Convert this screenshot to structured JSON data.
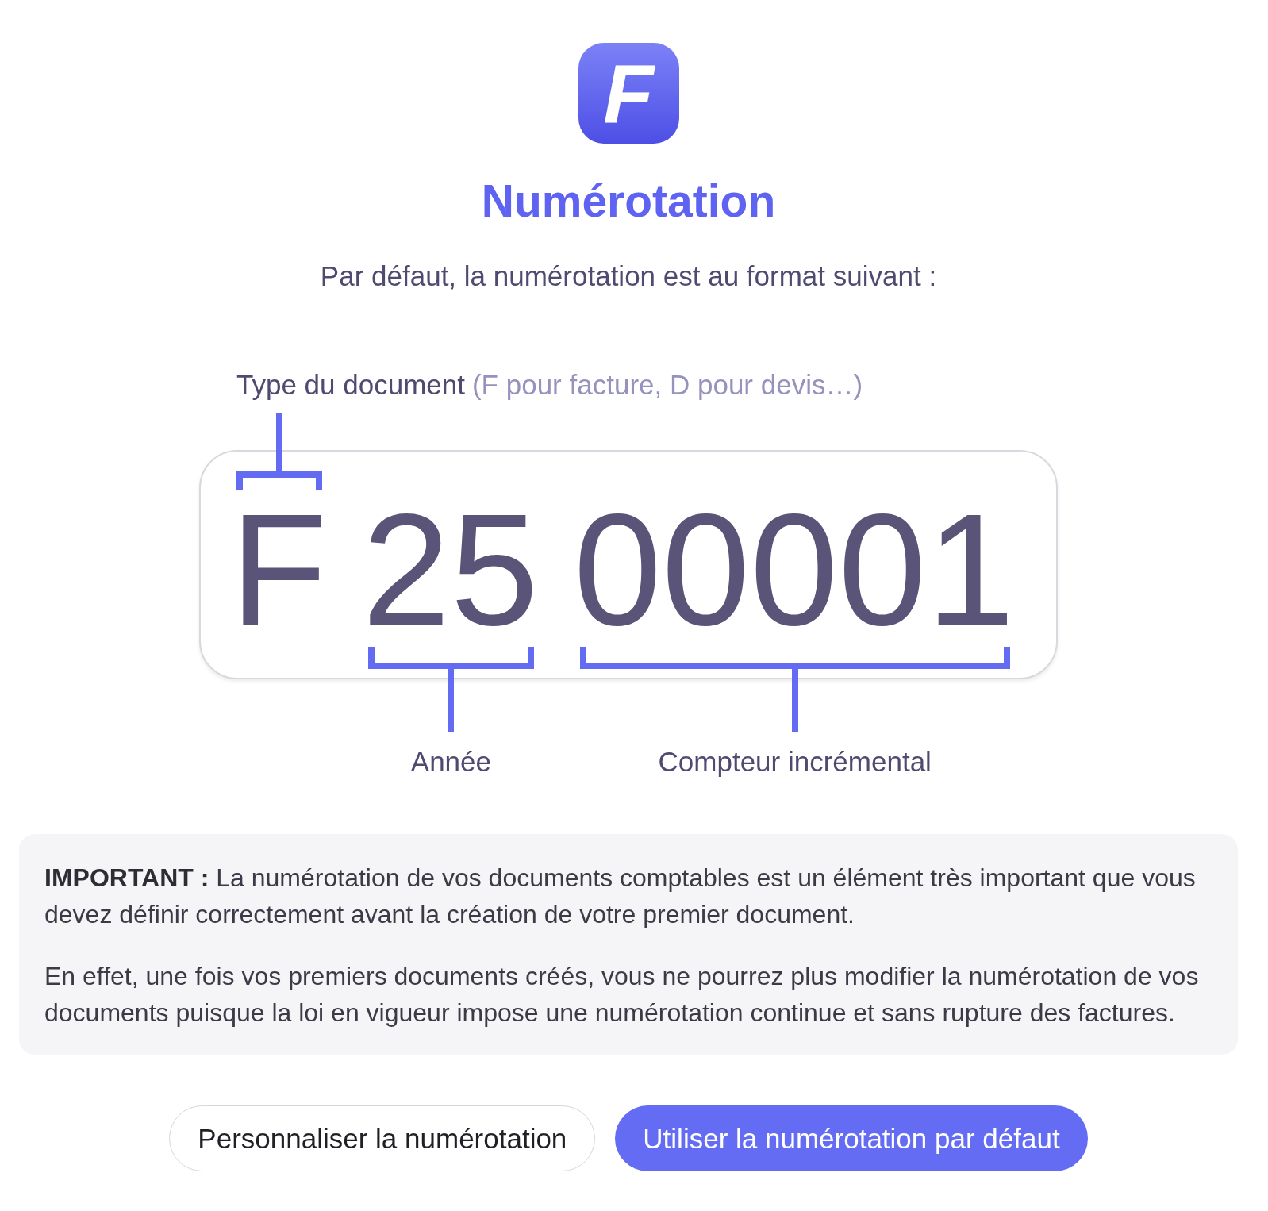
{
  "logo": {
    "letter": "F"
  },
  "title": "Numérotation",
  "caption": "Par défaut, la numérotation est au format suivant :",
  "format": {
    "segments": [
      {
        "value": "F",
        "kind": "above",
        "label": "Type du document",
        "note": "(F pour facture, D pour devis…)"
      },
      {
        "value": "25",
        "kind": "below",
        "label": "Année"
      },
      {
        "value": "00001",
        "kind": "below",
        "label": "Compteur incrémental"
      }
    ]
  },
  "notice": {
    "paragraphs": [
      "**IMPORTANT :** La numérotation de vos documents comptables est un élément très important que vous devez définir correctement avant la création de votre premier document.",
      "En effet, une fois vos premiers documents créés, vous ne pourrez plus modifier la numérotation de vos documents puisque la loi en vigueur impose une numérotation continue et sans rupture des factures."
    ]
  },
  "buttons": [
    {
      "label": "Personnaliser la numérotation",
      "kind": "secondary"
    },
    {
      "label": "Utiliser la numérotation par défaut",
      "kind": "primary"
    }
  ]
}
